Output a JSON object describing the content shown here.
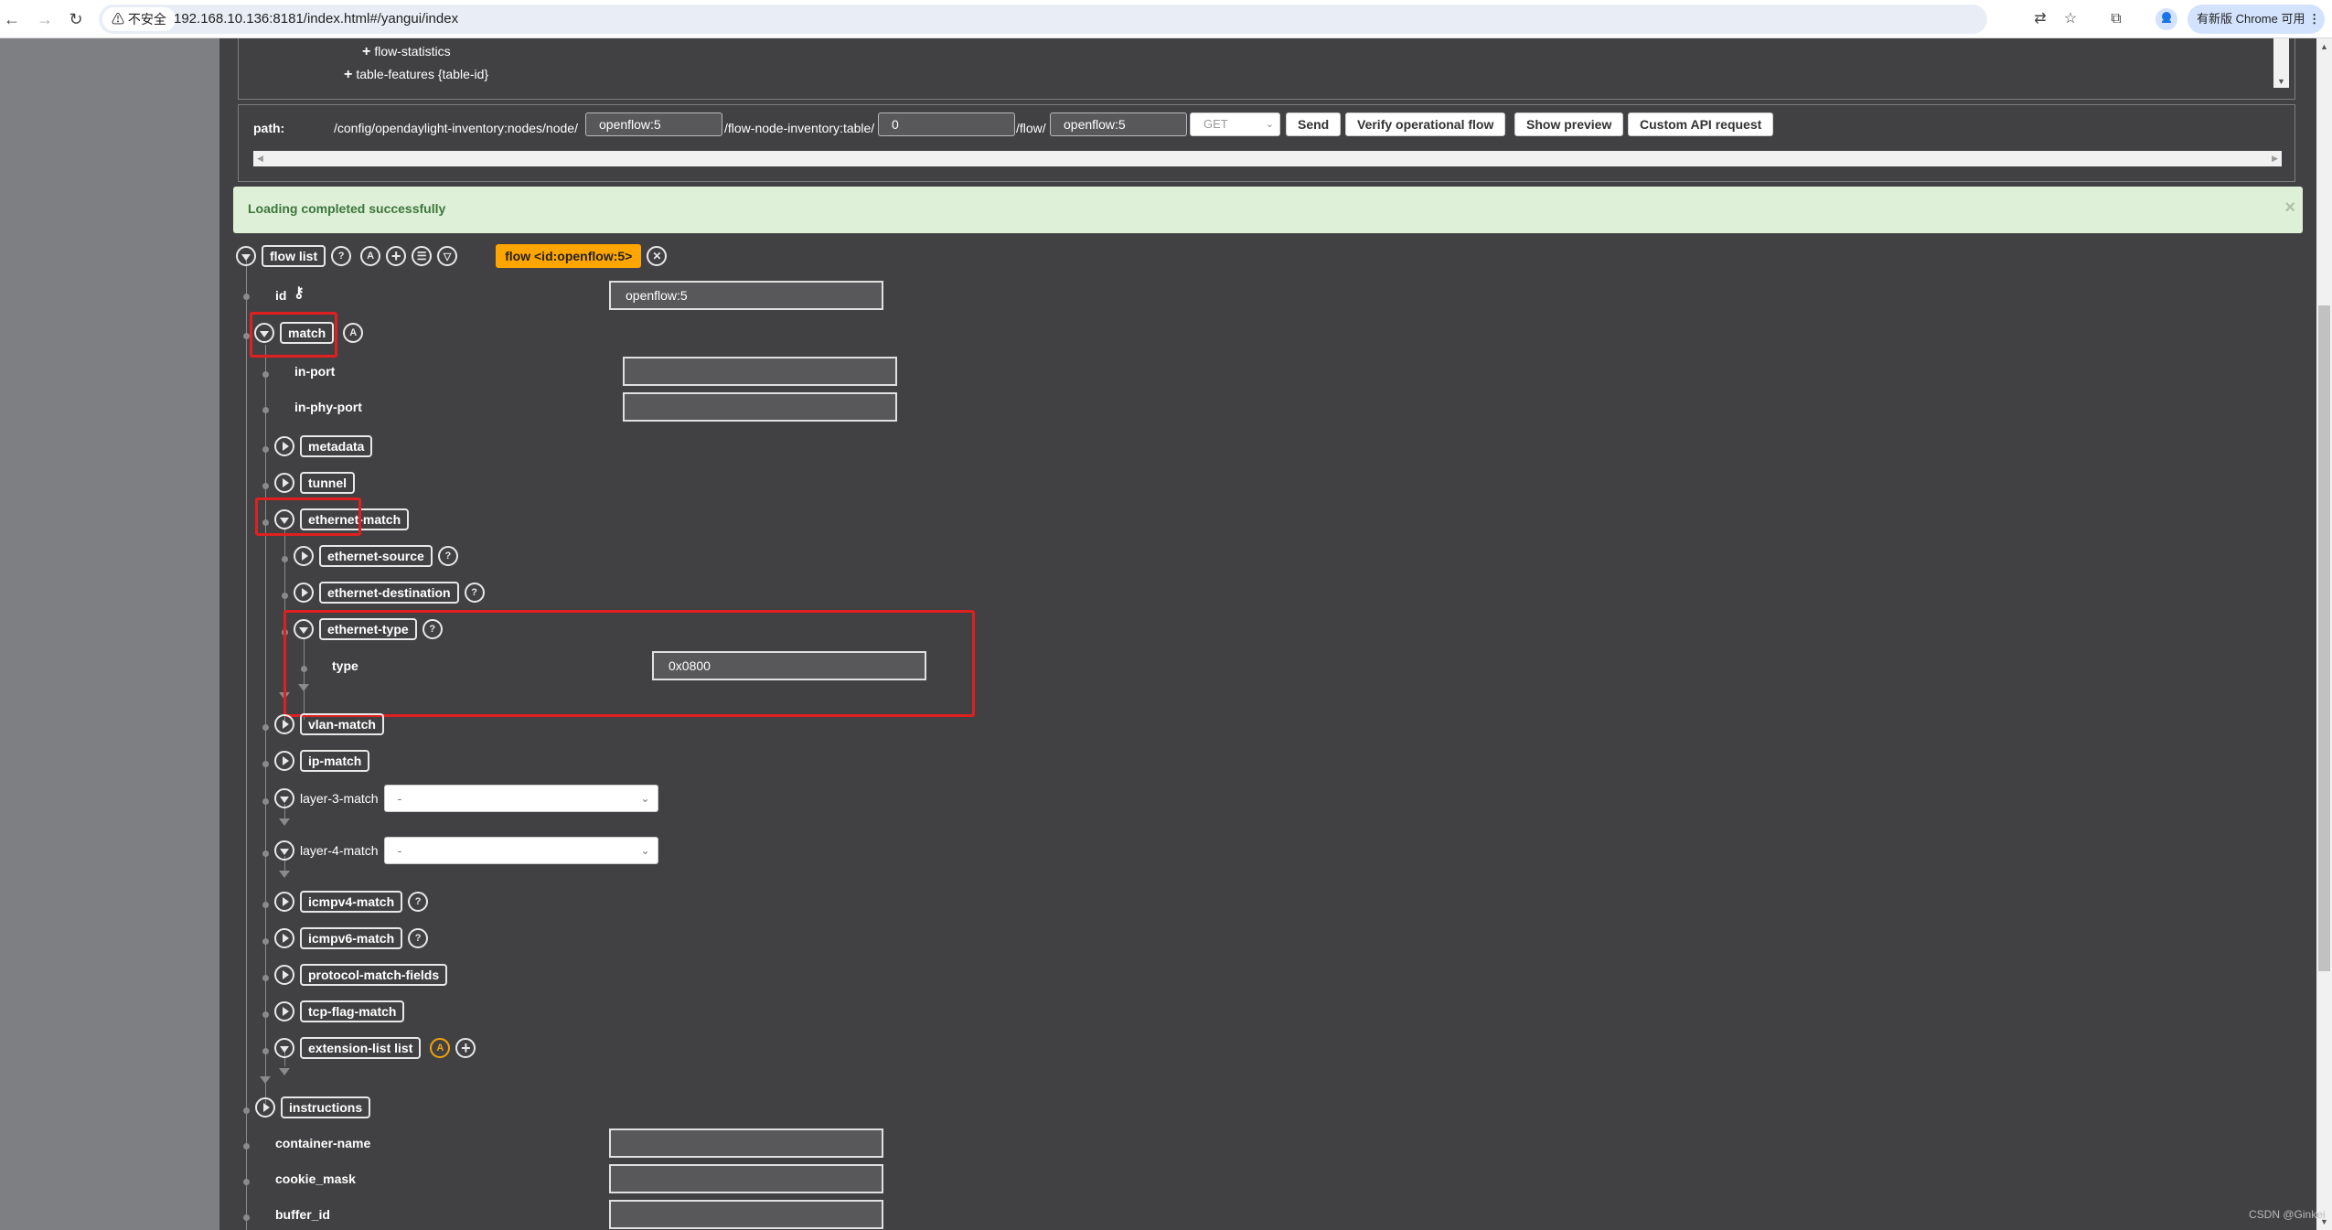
{
  "browser": {
    "back_icon": "arrow-left-icon",
    "forward_icon": "arrow-right-icon",
    "reload_icon": "reload-icon",
    "security_label": "不安全",
    "url": "192.168.10.136:8181/index.html#/yangui/index",
    "update_label": "有新版 Chrome 可用"
  },
  "tree_panel": {
    "items": [
      "flow-statistics",
      "table-features {table-id}"
    ]
  },
  "path_bar": {
    "label": "path:",
    "segments": [
      "/config/opendaylight-inventory:nodes/node/",
      "/flow-node-inventory:table/",
      "/flow/"
    ],
    "inputs": [
      "openflow:5",
      "0",
      "openflow:5"
    ],
    "method": "GET",
    "buttons": {
      "send": "Send",
      "verify": "Verify operational flow",
      "preview": "Show preview",
      "custom": "Custom API request"
    }
  },
  "alert": {
    "message": "Loading completed successfully",
    "close": "×"
  },
  "flow_list": {
    "label": "flow list",
    "tag": "flow  <id:openflow:5>"
  },
  "fields": {
    "id": {
      "label": "id",
      "value": "openflow:5"
    },
    "match": "match",
    "in_port": {
      "label": "in-port",
      "value": ""
    },
    "in_phy_port": {
      "label": "in-phy-port",
      "value": ""
    },
    "metadata": "metadata",
    "tunnel": "tunnel",
    "ethernet_match": "ethernet-match",
    "ethernet_source": "ethernet-source",
    "ethernet_destination": "ethernet-destination",
    "ethernet_type": "ethernet-type",
    "type": {
      "label": "type",
      "value": "0x0800"
    },
    "vlan_match": "vlan-match",
    "ip_match": "ip-match",
    "layer_3_match": {
      "label": "layer-3-match",
      "value": "-"
    },
    "layer_4_match": {
      "label": "layer-4-match",
      "value": "-"
    },
    "icmpv4_match": "icmpv4-match",
    "icmpv6_match": "icmpv6-match",
    "protocol_match_fields": "protocol-match-fields",
    "tcp_flag_match": "tcp-flag-match",
    "extension_list": "extension-list list",
    "instructions": "instructions",
    "container_name": {
      "label": "container-name",
      "value": ""
    },
    "cookie_mask": {
      "label": "cookie_mask",
      "value": ""
    },
    "buffer_id": {
      "label": "buffer_id",
      "value": ""
    }
  },
  "glyphs": {
    "help": "?",
    "augment": "A",
    "add": "+",
    "close": "✕",
    "key": "🔑︎"
  },
  "watermark": "CSDN @Ginkei"
}
